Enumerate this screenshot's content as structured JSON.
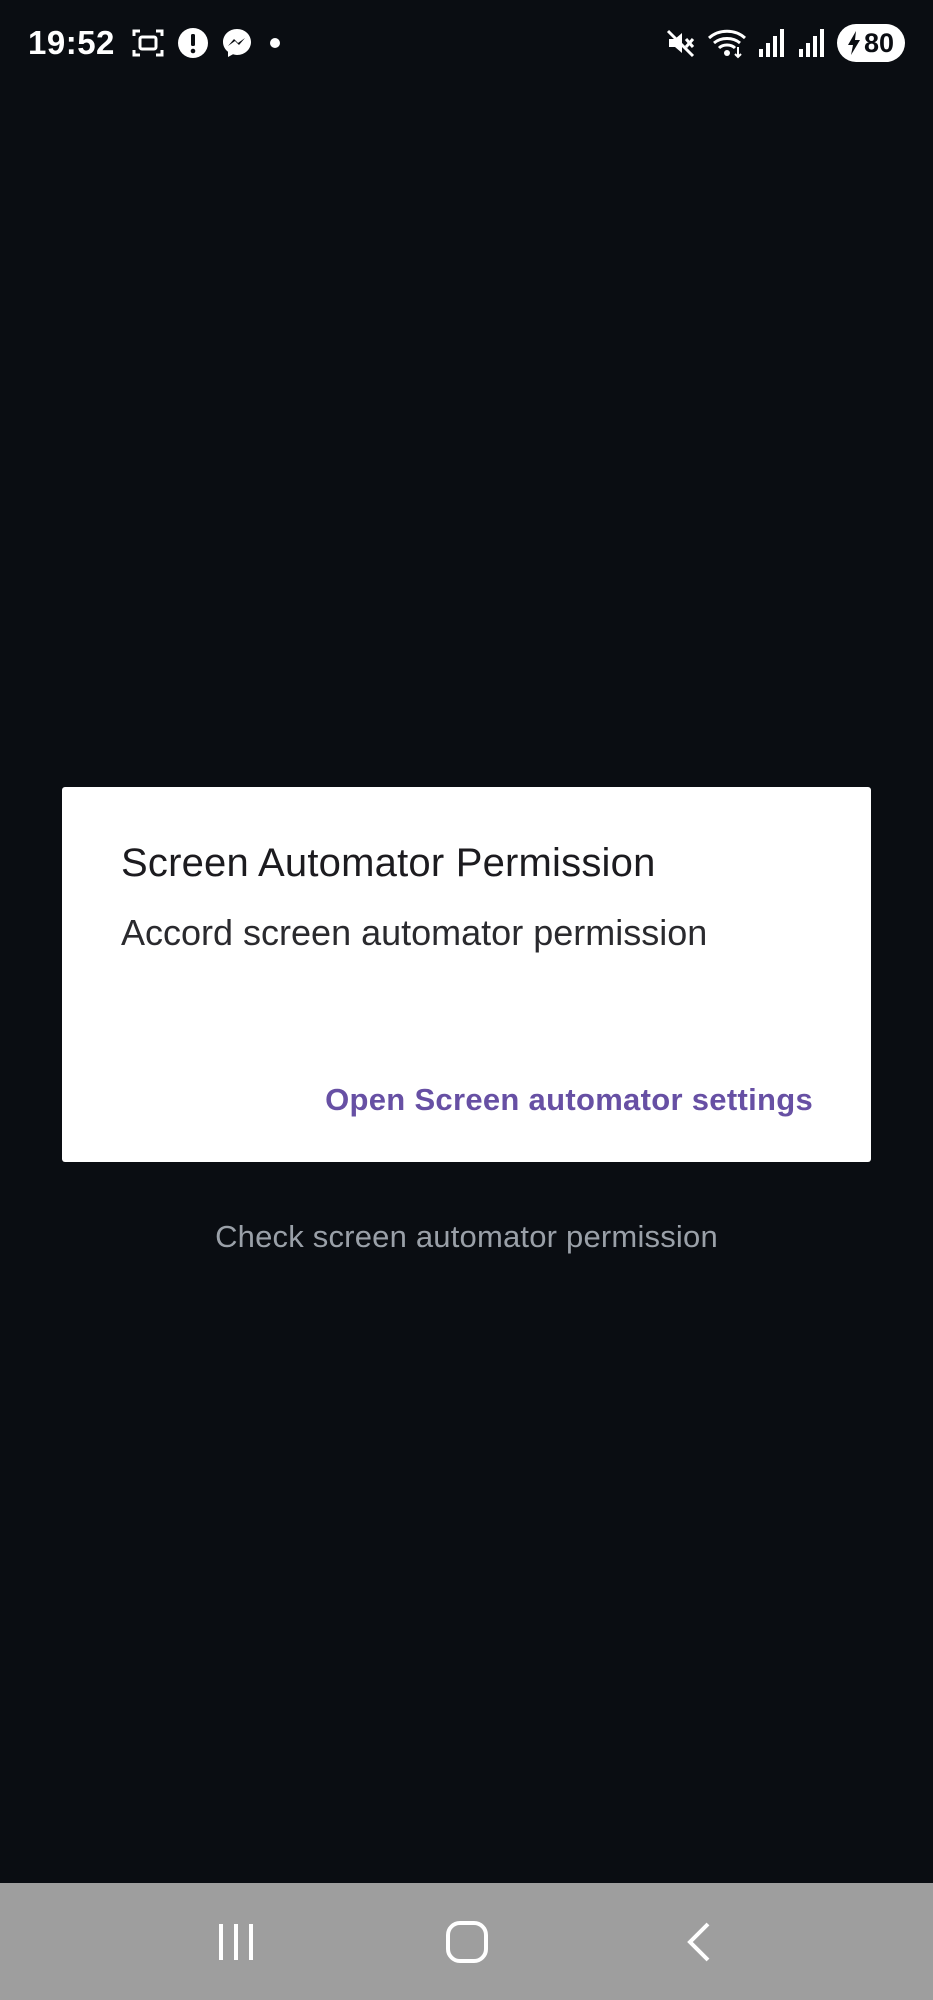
{
  "status_bar": {
    "time": "19:52",
    "battery_level": "80",
    "left_icons": [
      "screenshot-icon",
      "alert-icon",
      "messenger-icon",
      "dot-icon"
    ],
    "right_icons": [
      "mute-icon",
      "wifi-icon",
      "signal-icon",
      "signal-icon",
      "battery-icon"
    ]
  },
  "dialog": {
    "title": "Screen Automator Permission",
    "message": "Accord screen automator permission",
    "action_label": "Open Screen automator settings"
  },
  "background": {
    "button_label": "Check screen automator permission"
  },
  "nav_bar": {
    "buttons": [
      "recents-icon",
      "home-icon",
      "back-icon"
    ]
  },
  "colors": {
    "background": "#0a0d12",
    "dialog": "#ffffff",
    "accent": "#6750a4",
    "nav_bar": "#9e9e9e"
  }
}
